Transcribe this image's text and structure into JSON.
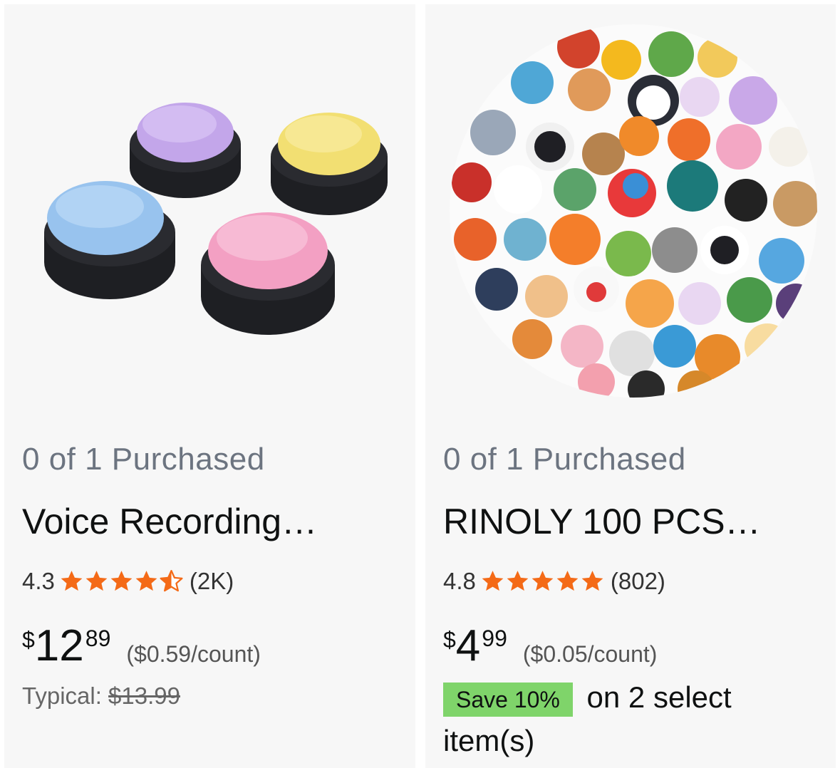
{
  "products": [
    {
      "image_alt": "Four round voice recording buttons in purple, yellow, blue and pink",
      "purchased": "0 of 1 Purchased",
      "title": "Voice Recording…",
      "rating": "4.3",
      "stars_filled": 4.5,
      "review_count": "(2K)",
      "price": {
        "currency": "$",
        "whole": "12",
        "fraction": "89"
      },
      "unit_price": "($0.59/count)",
      "typical_label": "Typical: ",
      "typical_price": "$13.99"
    },
    {
      "image_alt": "Round cluster of colorful cartoon animal stickers",
      "purchased": "0 of 1 Purchased",
      "title": "RINOLY 100 PCS…",
      "rating": "4.8",
      "stars_filled": 5,
      "review_count": "(802)",
      "price": {
        "currency": "$",
        "whole": "4",
        "fraction": "99"
      },
      "unit_price": "($0.05/count)",
      "save_badge": "Save 10%",
      "save_text": " on 2 select item(s)"
    }
  ],
  "colors": {
    "star": "#f46a17",
    "save_badge": "#7fd46a",
    "muted_text": "#6c7480"
  }
}
